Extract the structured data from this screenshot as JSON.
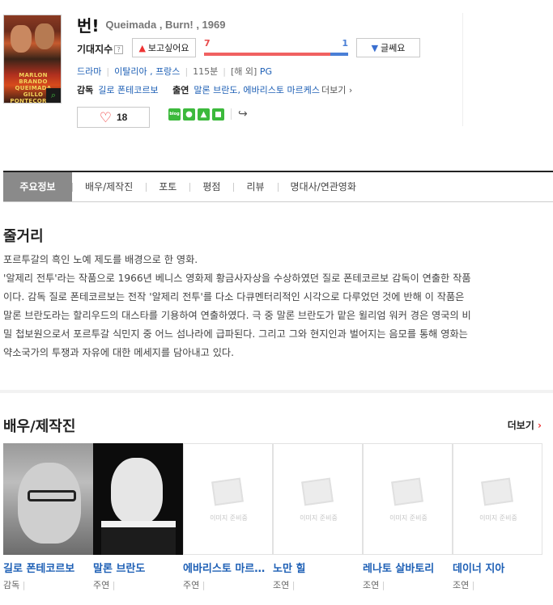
{
  "movie": {
    "title_ko": "번!",
    "title_original": "Queimada , Burn! , 1969",
    "poster_text": "MARLON BRANDO QUEIMADA GILLO PONTECORVO"
  },
  "expectation": {
    "label": "기대지수",
    "help": "?",
    "want_label": "보고싶어요",
    "want_count": "7",
    "dont_label": "글쎄요",
    "dont_count": "1",
    "want_share": 0.875
  },
  "meta": {
    "genre": "드라마",
    "countries": "이탈리아 , 프랑스",
    "runtime": "115분",
    "rating_prefix": "[해 외]",
    "rating": "PG"
  },
  "credits": {
    "director_label": "감독",
    "director": "길로 폰테코르보",
    "cast_label": "출연",
    "cast": "말론 브란도, 에바리스토 마르케스",
    "more": "더보기"
  },
  "like": {
    "count": "18"
  },
  "share": {
    "blog_label": "blog"
  },
  "tabs": [
    "주요정보",
    "배우/제작진",
    "포토",
    "평점",
    "리뷰",
    "명대사/연관영화"
  ],
  "synopsis": {
    "heading": "줄거리",
    "lines": [
      "포르투갈의 흑인 노예 제도를 배경으로 한 영화.",
      " '알제리 전투'라는 작품으로 1966년 베니스 영화제 황금사자상을 수상하였던 질로 폰테코르보 감독이 연출한 작품",
      "이다. 감독 질로 폰테코르보는 전작 '알제리 전투'를 다소 다큐멘터리적인 시각으로 다루었던 것에 반해 이 작품은",
      "말론 브란도라는 할리우드의 대스타를 기용하여 연출하였다. 극 중 말론 브란도가 맡은 윌리엄 워커 경은 영국의 비",
      "밀 첩보원으로서 포르투갈 식민지 중 어느 섬나라에 급파된다. 그리고 그와 현지인과 벌어지는 음모를 통해 영화는",
      "약소국가의 투쟁과 자유에 대한 메세지를 담아내고 있다."
    ]
  },
  "cast_section": {
    "heading": "배우/제작진",
    "more": "더보기",
    "placeholder_text": "이미지 준비중",
    "people": [
      {
        "name": "길로 폰테코르보",
        "role": "감독",
        "image": "photo"
      },
      {
        "name": "말론 브란도",
        "role": "주연",
        "image": "photo"
      },
      {
        "name": "에바리스토 마르케스",
        "role": "주연",
        "image": "placeholder"
      },
      {
        "name": "노만 힐",
        "role": "조연",
        "image": "placeholder"
      },
      {
        "name": "레나토 살바토리",
        "role": "조연",
        "image": "placeholder"
      },
      {
        "name": "데이너 지아",
        "role": "조연",
        "image": "placeholder"
      }
    ]
  },
  "colors": {
    "want": "#f06161",
    "dont": "#4a7fd6",
    "link": "#1d5fb5",
    "active_tab": "#8a8a8a",
    "share_green": "#3cb93c"
  }
}
